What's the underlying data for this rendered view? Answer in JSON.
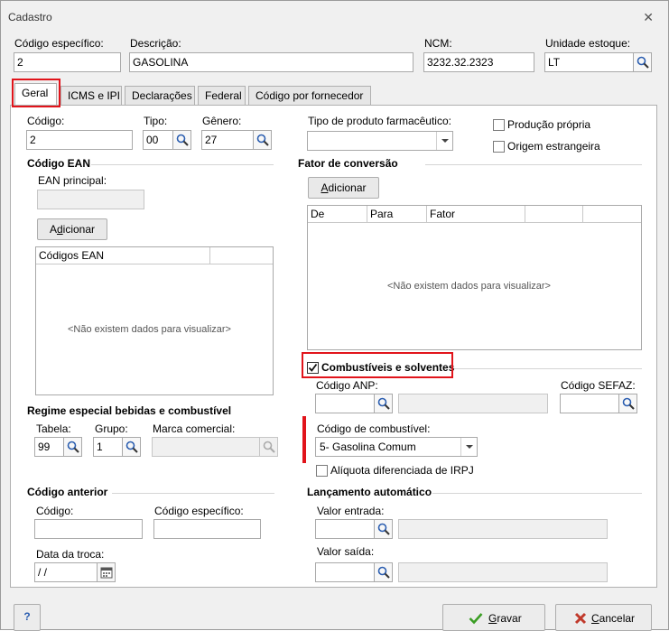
{
  "window": {
    "title": "Cadastro"
  },
  "header": {
    "codigo_especifico_label": "Código específico:",
    "codigo_especifico_value": "2",
    "descricao_label": "Descrição:",
    "descricao_value": "GASOLINA",
    "ncm_label": "NCM:",
    "ncm_value": "3232.32.2323",
    "unidade_label": "Unidade estoque:",
    "unidade_value": "LT"
  },
  "tabs": [
    "Geral",
    "ICMS e IPI",
    "Declarações",
    "Federal",
    "Código por fornecedor"
  ],
  "geral": {
    "codigo_label": "Código:",
    "codigo_value": "2",
    "tipo_label": "Tipo:",
    "tipo_value": "00",
    "genero_label": "Gênero:",
    "genero_value": "27",
    "tipo_farm_label": "Tipo de produto farmacêutico:",
    "producao_propria": "Produção própria",
    "origem_estrangeira": "Origem estrangeira",
    "ean_section": "Código EAN",
    "ean_principal_label": "EAN principal:",
    "ean_add_btn_prefix": "A",
    "ean_add_btn_u": "d",
    "ean_add_btn_rest": "icionar",
    "ean_grid_header": "Códigos EAN",
    "empty_text": "<Não existem dados para visualizar>",
    "fator_section": "Fator de conversão",
    "fator_add_btn_u": "A",
    "fator_add_btn_rest": "dicionar",
    "fator_cols": [
      "De",
      "Para",
      "Fator"
    ],
    "combustiveis_label": "Combustíveis e solventes",
    "codigo_anp_label": "Código ANP:",
    "codigo_sefaz_label": "Código SEFAZ:",
    "codigo_combustivel_label": "Código de combustível:",
    "codigo_combustivel_value": "5- Gasolina Comum",
    "aliquota_label": "Alíquota diferenciada de IRPJ",
    "regime_section": "Regime especial bebidas e combustível",
    "tabela_label": "Tabela:",
    "tabela_value": "99",
    "grupo_label": "Grupo:",
    "grupo_value": "1",
    "marca_label": "Marca comercial:",
    "anterior_section": "Código anterior",
    "anterior_codigo_label": "Código:",
    "anterior_especifico_label": "Código específico:",
    "data_troca_label": "Data da troca:",
    "data_troca_value": " / /",
    "lancamento_section": "Lançamento automático",
    "valor_entrada_label": "Valor entrada:",
    "valor_saida_label": "Valor saída:"
  },
  "footer": {
    "help": "?",
    "gravar_u": "G",
    "gravar_rest": "ravar",
    "cancelar_u": "C",
    "cancelar_rest": "ancelar"
  },
  "colors": {
    "highlight": "#e1141b",
    "check": "#2e7d32",
    "cancel": "#c0392b"
  }
}
